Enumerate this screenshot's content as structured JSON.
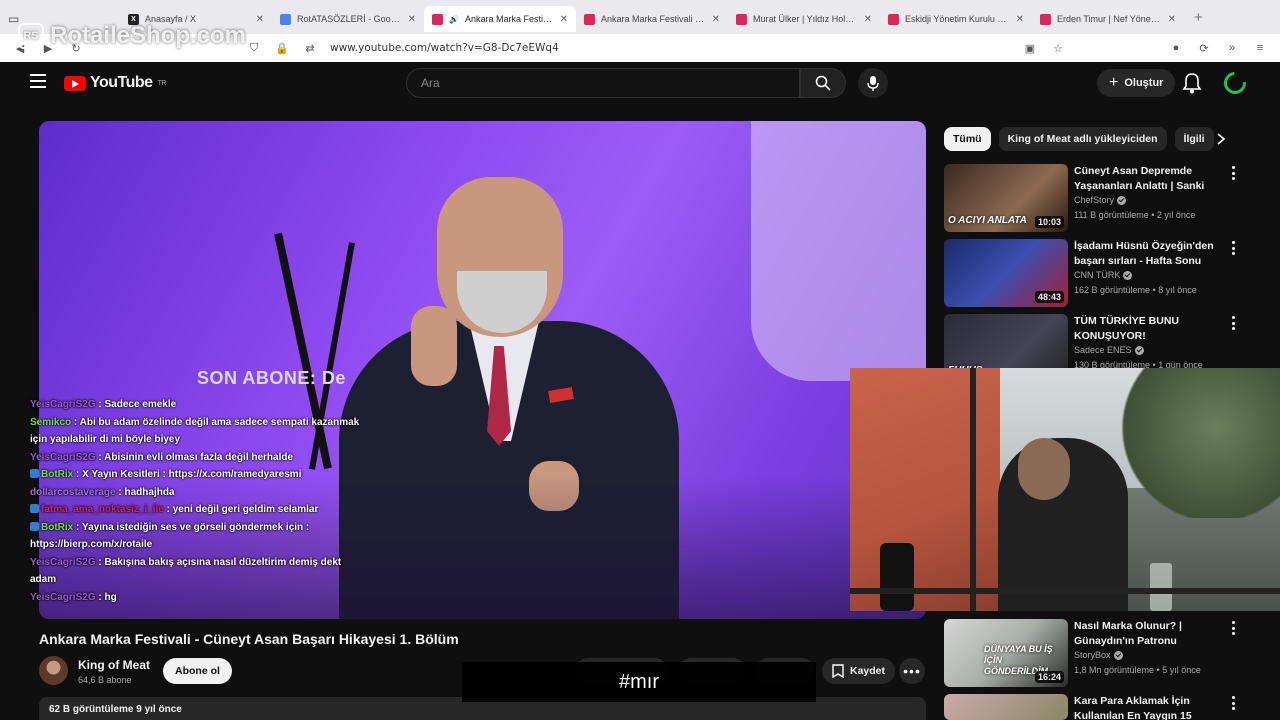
{
  "browser": {
    "tabs": [
      {
        "label": "",
        "kind": "first"
      },
      {
        "label": "Anasayfa / X",
        "kind": "xx"
      },
      {
        "label": "RotATASÖZLERİ - Google D",
        "kind": "gd"
      },
      {
        "label": "Ankara Marka Festivali",
        "kind": "yt",
        "active": true
      },
      {
        "label": "Ankara Marka Festivali - Cün",
        "kind": "yt"
      },
      {
        "label": "Murat Ülker | Yıldız Holding",
        "kind": "yt"
      },
      {
        "label": "Eskidji Yönetim Kurulu Başk",
        "kind": "yt"
      },
      {
        "label": "Erden Timur | Nef Yönetim K",
        "kind": "yt"
      }
    ],
    "url": "www.youtube.com/watch?v=G8-Dc7eEWq4"
  },
  "watermark": {
    "badge": "RS",
    "text": "RotaileShop.com"
  },
  "youtube": {
    "logo_text": "YouTube",
    "logo_region": "TR",
    "search_placeholder": "Ara",
    "create_label": "Oluştur"
  },
  "video": {
    "overlay_text": "SON ABONE: De",
    "title": "Ankara Marka Festivali - Cüneyt Asan Başarı Hikayesi 1. Bölüm",
    "channel": "King of Meat",
    "subscribers": "64,6 B abone",
    "subscribe_label": "Abone ol",
    "save_label": "Kaydet",
    "description_meta": "62 B görüntüleme  9 yıl önce",
    "lower_banner": "#mır"
  },
  "chat": [
    {
      "name": "YeisCagriS2G",
      "cls": "n1",
      "msg": "Sadece emekle"
    },
    {
      "name": "Semikco",
      "cls": "n2",
      "msg": "Abi bu adam özelinde değil ama sadece sempati kazanmak için yapılabilir di mi böyle biyey"
    },
    {
      "name": "YeisCagriS2G",
      "cls": "n1",
      "msg": "Abisinin evli olması fazla değil herhalde"
    },
    {
      "name": "BotRix",
      "cls": "n2",
      "badge": true,
      "msg": "X Yayın Kesitleri : https://x.com/ramedyaresmi"
    },
    {
      "name": "dollarcostaverage",
      "cls": "n3",
      "msg": "hadhajhda"
    },
    {
      "name": "fatma_ama_noktasiz_i_ile",
      "cls": "n6",
      "badge": true,
      "msg": "yeni değil geri geldim selamlar"
    },
    {
      "name": "BotRix",
      "cls": "n2",
      "badge": true,
      "msg": "Yayına istediğin ses ve görseli göndermek için : https://bierp.com/x/rotaile"
    },
    {
      "name": "YeisCagriS2G",
      "cls": "n1",
      "msg": "Bakışına bakış açısına nasıl düzeltirim demiş dekt adam"
    },
    {
      "name": "YeisCagriS2G",
      "cls": "n1",
      "msg": "hg"
    }
  ],
  "sidebar": {
    "chips": [
      "Tümü",
      "King of Meat adlı yükleyiciden",
      "İlgili"
    ],
    "recs": [
      {
        "title": "Cüneyt Asan Depremde Yaşananları Anlattı | Sanki ...",
        "channel": "ChefStory",
        "meta": "111 B görüntüleme • 2 yıl önce",
        "duration": "10:03",
        "thumb_text": "O ACIYI ANLATA"
      },
      {
        "title": "İşadamı Hüsnü Özyeğin'den başarı sırları - Hafta Sonu 28 ...",
        "channel": "CNN TÜRK",
        "meta": "162 B görüntüleme • 8 yıl önce",
        "duration": "48:43",
        "thumb_text": ""
      },
      {
        "title": "TÜM TÜRKİYE BUNU KONUŞUYOR!",
        "channel": "Sadece ENES",
        "meta": "130 B görüntüleme • 1 gün önce",
        "duration": "",
        "thumb_text": "FUHUŞ"
      },
      {
        "title": "Nasıl Marka Olunur? | Günaydın'ın Patronu Cüneyt ...",
        "channel": "StoryBox",
        "meta": "1,8 Mn görüntüleme • 5 yıl önce",
        "duration": "16:24",
        "thumb_text": "DÜNYAYA BU İŞ İÇİN GÖNDERİLDİM"
      },
      {
        "title": "Kara Para Aklamak İçin Kullanılan En Yaygın 15 işletme",
        "channel": "",
        "meta": "",
        "duration": "",
        "thumb_text": ""
      }
    ]
  }
}
